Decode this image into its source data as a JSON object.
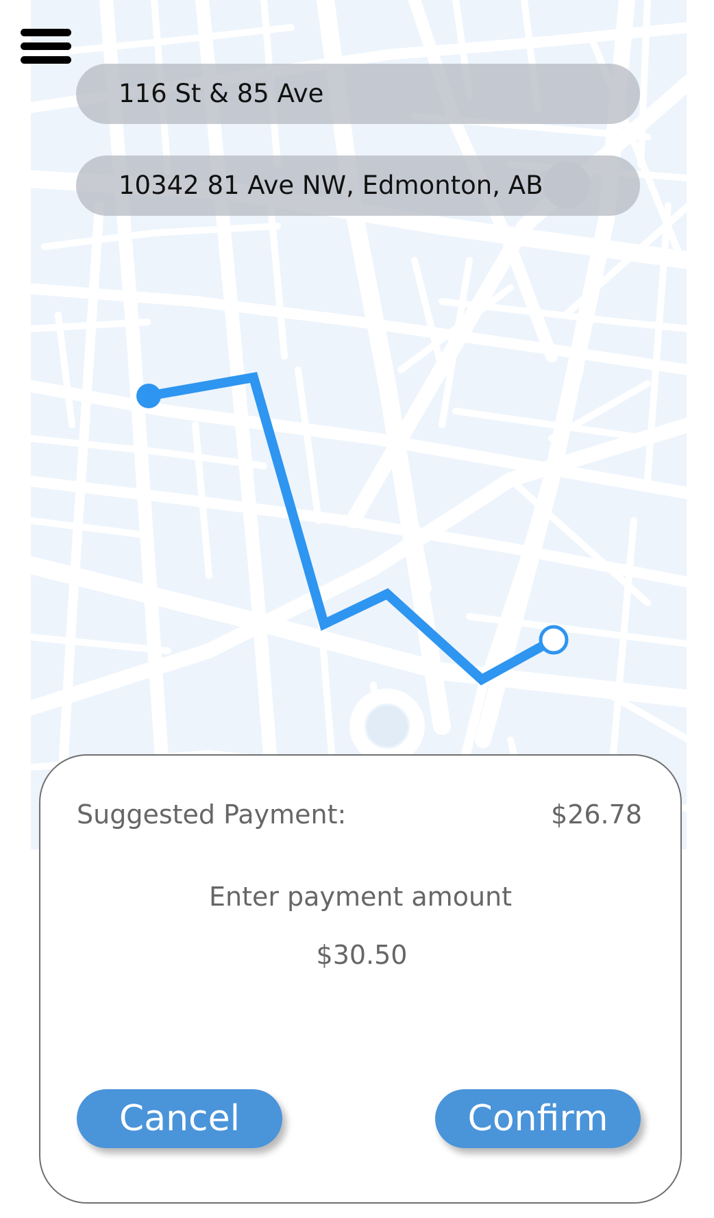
{
  "route": {
    "pickup_address": "116 St & 85 Ave",
    "dropoff_address": "10342 81 Ave NW, Edmonton, AB"
  },
  "payment": {
    "suggested_label": "Suggested Payment:",
    "suggested_value": "$26.78",
    "enter_label": "Enter payment amount",
    "amount_value": "$30.50"
  },
  "actions": {
    "cancel_label": "Cancel",
    "confirm_label": "Confirm"
  },
  "icons": {
    "menu": "hamburger-menu-icon",
    "route_start": "route-start-dot",
    "route_end": "route-end-marker"
  },
  "colors": {
    "route_line": "#2e95f0",
    "map_background": "#edf4fc",
    "map_streets": "#ffffff",
    "button_fill": "#4a94da",
    "address_pill": "#b8bcc4"
  }
}
